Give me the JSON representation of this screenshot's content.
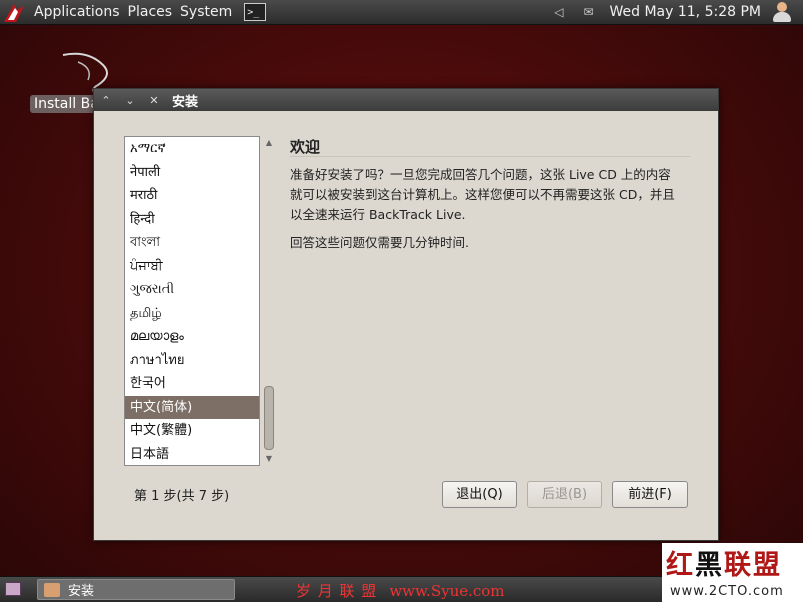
{
  "top_panel": {
    "menus": [
      "Applications",
      "Places",
      "System"
    ],
    "terminal_glyph": ">_",
    "clock": "Wed May 11,  5:28 PM"
  },
  "desktop": {
    "install_label": "Install Ba"
  },
  "window": {
    "title": "安装",
    "languages": [
      "አማርኛ",
      "नेपाली",
      "मराठी",
      "हिन्दी",
      "বাংলা",
      "ਪੰਜਾਬੀ",
      "ગુજરાતી",
      "தமிழ்",
      "മലയാളം",
      "ภาษาไทย",
      "한국어",
      "中文(简体)",
      "中文(繁體)",
      "日本語"
    ],
    "selected_language": "中文(简体)",
    "welcome_title": "欢迎",
    "welcome_line1": "准备好安装了吗？一旦您完成回答几个问题，这张 Live CD 上的内容",
    "welcome_line2": "就可以被安装到这台计算机上。这样您便可以不再需要这张 CD，并且",
    "welcome_line3": "以全速来运行 BackTrack Live.",
    "welcome_note": "回答这些问题仅需要几分钟时间.",
    "step": "第 1 步(共 7 步)",
    "buttons": {
      "quit": "退出(Q)",
      "back": "后退(B)",
      "forward": "前进(F)"
    }
  },
  "taskbar": {
    "task_label": "安装",
    "watermark_cn": "岁 月 联 盟",
    "watermark_url": "www.Syue.com"
  },
  "corner_watermark": {
    "chars": [
      "红",
      "黑",
      "联",
      "盟"
    ],
    "url": "www.2CTO.com"
  }
}
